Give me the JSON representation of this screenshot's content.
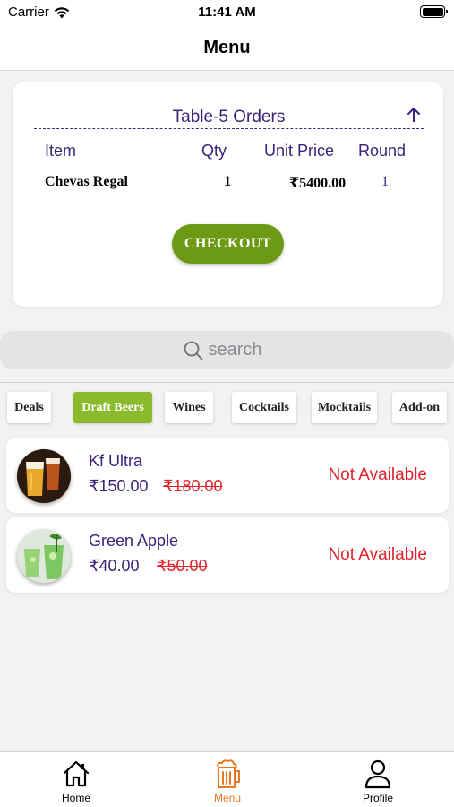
{
  "status_bar": {
    "carrier": "Carrier",
    "time": "11:41 AM"
  },
  "nav": {
    "title": "Menu"
  },
  "orders": {
    "title": "Table-5 Orders",
    "columns": [
      "Item",
      "Qty",
      "Unit Price",
      "Round"
    ],
    "rows": [
      {
        "item": "Chevas Regal",
        "qty": "1",
        "unit_price": "₹5400.00",
        "round": "1"
      }
    ],
    "checkout_label": "CHECKOUT"
  },
  "search": {
    "placeholder": "search"
  },
  "categories": {
    "items": [
      "Deals",
      "Draft Beers",
      "Wines",
      "Cocktails",
      "Mocktails",
      "Add-on"
    ],
    "active": "Draft Beers"
  },
  "menu_items": [
    {
      "name": "Kf Ultra",
      "price": "₹150.00",
      "old_price": "₹180.00",
      "status": "Not Available",
      "image_icon": "beer-glasses-photo"
    },
    {
      "name": "Green Apple",
      "price": "₹40.00",
      "old_price": "₹50.00",
      "status": "Not Available",
      "image_icon": "green-drink-photo"
    }
  ],
  "tab_bar": {
    "items": [
      {
        "label": "Home",
        "icon": "home-icon"
      },
      {
        "label": "Menu",
        "icon": "beer-mug-icon"
      },
      {
        "label": "Profile",
        "icon": "profile-icon"
      }
    ],
    "active": "Menu"
  },
  "colors": {
    "accent_purple": "#3a237a",
    "checkout_green": "#6d9a14",
    "active_tab_green": "#8bbb2c",
    "unavailable_red": "#e0222a",
    "active_nav_orange": "#e87722"
  }
}
